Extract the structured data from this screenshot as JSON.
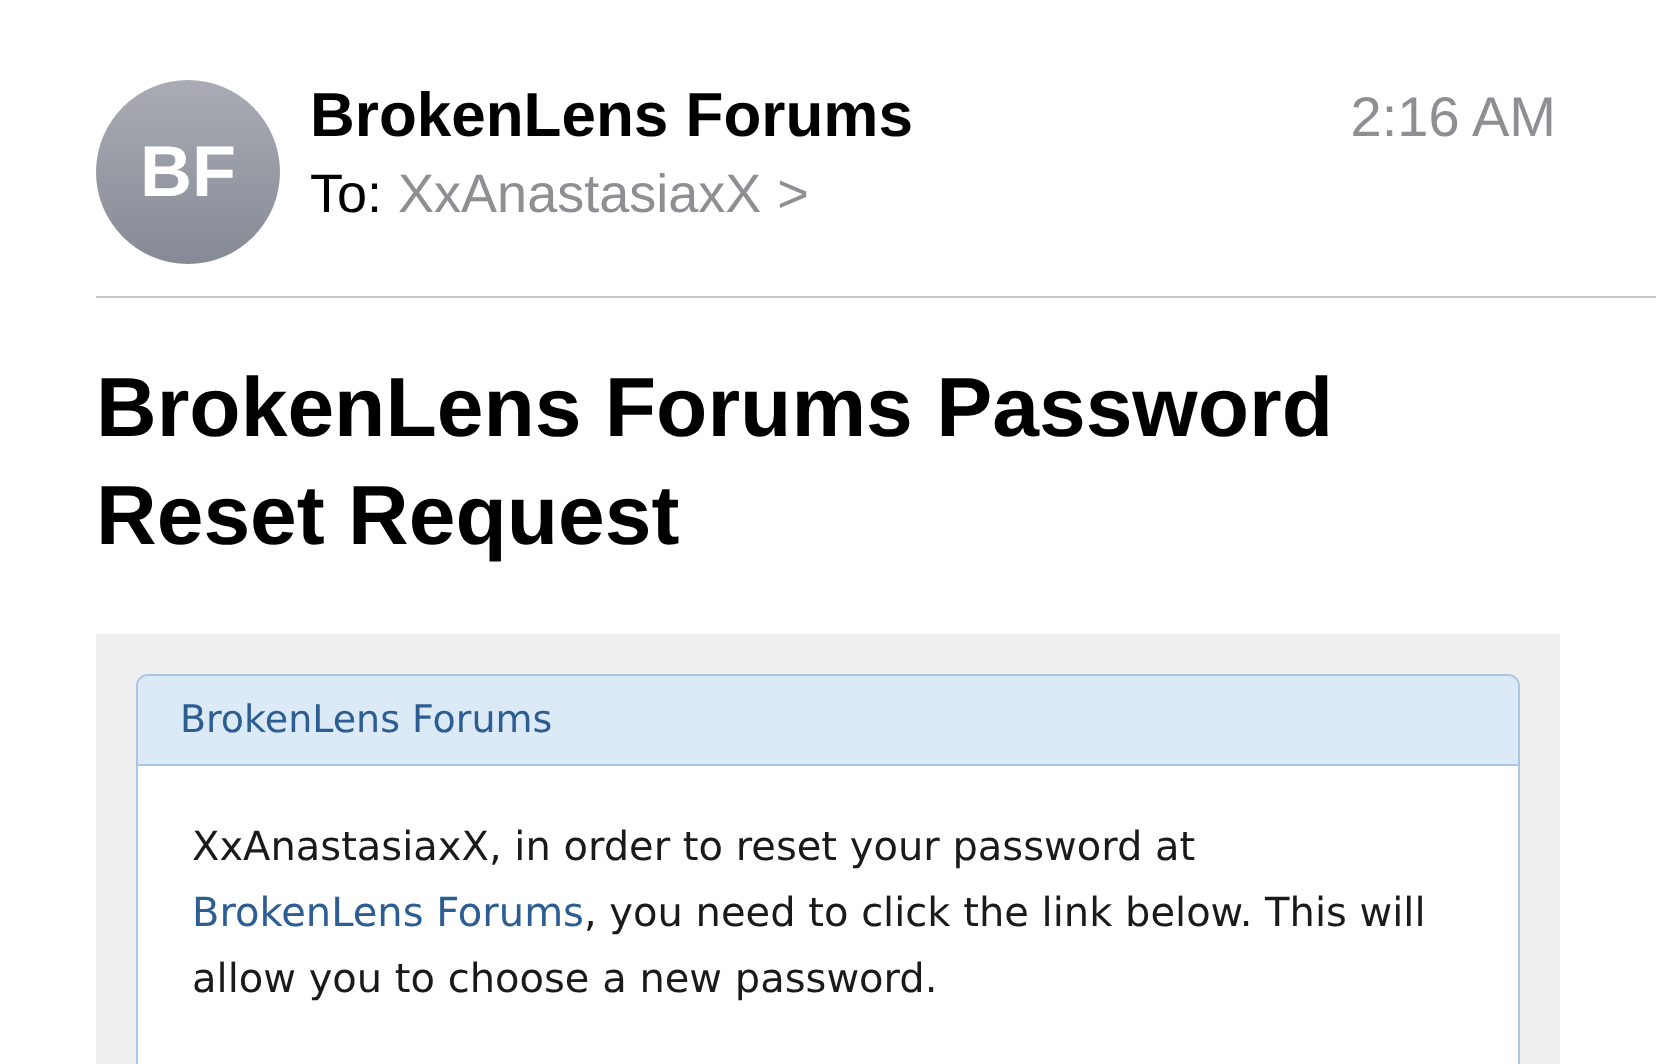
{
  "header": {
    "avatar_initials": "BF",
    "sender": "BrokenLens Forums",
    "time": "2:16 AM",
    "to_label": "To:",
    "recipient": "XxAnastasiaxX",
    "chevron": ">"
  },
  "subject": "BrokenLens Forums Password Reset Request",
  "card": {
    "title": "BrokenLens Forums",
    "text_before": "XxAnastasiaxX, in order to reset your password at ",
    "link": "BrokenLens Forums",
    "text_after": ", you need to click the link below. This will allow you to choose a new password."
  }
}
